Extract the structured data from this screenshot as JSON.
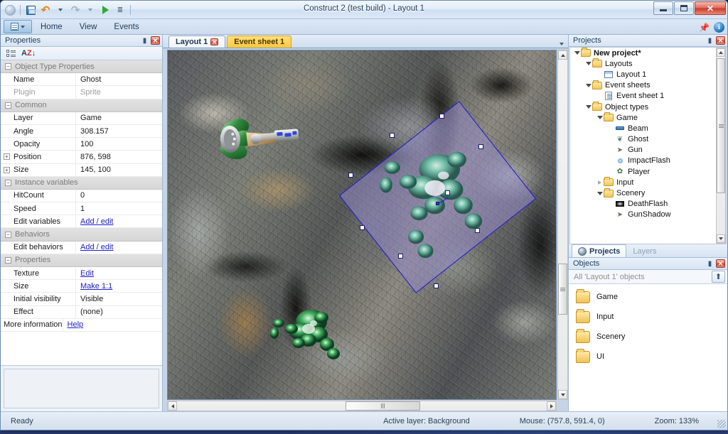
{
  "window": {
    "title": "Construct 2 (test build) - Layout 1",
    "quick_access": [
      {
        "name": "app-orb",
        "icon": "orb-icon"
      },
      {
        "name": "save",
        "icon": "floppy-disk-icon"
      },
      {
        "name": "undo",
        "icon": "undo-arrow-icon"
      },
      {
        "name": "undo-dropdown",
        "icon": "chevron-down-icon"
      },
      {
        "name": "redo",
        "icon": "redo-arrow-icon"
      },
      {
        "name": "redo-dropdown",
        "icon": "chevron-down-icon"
      },
      {
        "name": "run",
        "icon": "play-icon"
      },
      {
        "name": "customize",
        "icon": "overflow-icon"
      }
    ],
    "controls": {
      "minimize": "minimize-icon",
      "maximize": "maximize-icon",
      "close": "✕"
    }
  },
  "ribbon": {
    "app_button": "File menu",
    "tabs": [
      {
        "label": "Home",
        "active": false
      },
      {
        "label": "View",
        "active": false
      },
      {
        "label": "Events",
        "active": false
      }
    ],
    "pin": "🖇",
    "help": "i"
  },
  "properties_panel": {
    "title": "Properties",
    "pin_glyph": "▮",
    "close_glyph": "✕",
    "toolbar": {
      "categorized": "categorized-view-icon",
      "alphabetical_a": "A",
      "alphabetical_z": "Z",
      "sort_arrow": "↓"
    },
    "rows": [
      {
        "kind": "group",
        "name": "Object Type Properties",
        "value": "",
        "expander": "−"
      },
      {
        "kind": "prop",
        "name": "Name",
        "value": "Ghost"
      },
      {
        "kind": "prop",
        "name": "Plugin",
        "value": "Sprite",
        "dim": true
      },
      {
        "kind": "group",
        "name": "Common",
        "value": "",
        "expander": "−"
      },
      {
        "kind": "prop",
        "name": "Layer",
        "value": "Game"
      },
      {
        "kind": "prop",
        "name": "Angle",
        "value": "308.157"
      },
      {
        "kind": "prop",
        "name": "Opacity",
        "value": "100"
      },
      {
        "kind": "prop",
        "name": "Position",
        "value": "876, 598",
        "sub": "+"
      },
      {
        "kind": "prop",
        "name": "Size",
        "value": "145, 100",
        "sub": "+"
      },
      {
        "kind": "group",
        "name": "Instance variables",
        "value": "",
        "expander": "−"
      },
      {
        "kind": "prop",
        "name": "HitCount",
        "value": "0"
      },
      {
        "kind": "prop",
        "name": "Speed",
        "value": "1"
      },
      {
        "kind": "prop",
        "name": "Edit variables",
        "value": "Add / edit",
        "link": true
      },
      {
        "kind": "group",
        "name": "Behaviors",
        "value": "",
        "expander": "−"
      },
      {
        "kind": "prop",
        "name": "Edit behaviors",
        "value": "Add / edit",
        "link": true
      },
      {
        "kind": "group",
        "name": "Properties",
        "value": "",
        "expander": "−"
      },
      {
        "kind": "prop",
        "name": "Texture",
        "value": "Edit",
        "link": true
      },
      {
        "kind": "prop",
        "name": "Size",
        "value": "Make 1:1",
        "link": true
      },
      {
        "kind": "prop",
        "name": "Initial visibility",
        "value": "Visible"
      },
      {
        "kind": "prop",
        "name": "Effect",
        "value": "(none)"
      },
      {
        "kind": "prop",
        "name": "More information",
        "value": "Help",
        "link": true,
        "nosplit": true
      }
    ],
    "description": ""
  },
  "view_tabs": [
    {
      "label": "Layout 1",
      "active": true,
      "closable": true,
      "close_glyph": "✕",
      "kind": "layout"
    },
    {
      "label": "Event sheet 1",
      "active": false,
      "closable": false,
      "kind": "eventsheet"
    }
  ],
  "view_tabs_menu": "chevron-down-icon",
  "canvas": {
    "sprites": [
      {
        "name": "player-gun-sprite",
        "label": "Player"
      },
      {
        "name": "ghost-sprite-green",
        "label": "Ghost"
      },
      {
        "name": "ghost-sprite-selected",
        "label": "Ghost (selected)"
      }
    ],
    "selection": {
      "angle_deg": 308.157,
      "handles": 8,
      "fill_color": "#968ccd",
      "outline_color": "#1b16d6"
    }
  },
  "projects_panel": {
    "title": "Projects",
    "pin_glyph": "▮",
    "close_glyph": "✕",
    "tree": [
      {
        "label": "New project*",
        "depth": 0,
        "icon": "folder-icon",
        "twisty": "open",
        "bold": true
      },
      {
        "label": "Layouts",
        "depth": 1,
        "icon": "folder-icon",
        "twisty": "open"
      },
      {
        "label": "Layout 1",
        "depth": 2,
        "icon": "layout-icon",
        "twisty": "none"
      },
      {
        "label": "Event sheets",
        "depth": 1,
        "icon": "folder-icon",
        "twisty": "open"
      },
      {
        "label": "Event sheet 1",
        "depth": 2,
        "icon": "event-sheet-icon",
        "twisty": "none"
      },
      {
        "label": "Object types",
        "depth": 1,
        "icon": "folder-icon",
        "twisty": "open"
      },
      {
        "label": "Game",
        "depth": 2,
        "icon": "folder-icon",
        "twisty": "open"
      },
      {
        "label": "Beam",
        "depth": 3,
        "icon": "beam-icon",
        "twisty": "none"
      },
      {
        "label": "Ghost",
        "depth": 3,
        "icon": "ghost-icon",
        "twisty": "none"
      },
      {
        "label": "Gun",
        "depth": 3,
        "icon": "gun-icon",
        "twisty": "none"
      },
      {
        "label": "ImpactFlash",
        "depth": 3,
        "icon": "impact-flash-icon",
        "twisty": "none"
      },
      {
        "label": "Player",
        "depth": 3,
        "icon": "player-icon",
        "twisty": "none"
      },
      {
        "label": "Input",
        "depth": 2,
        "icon": "folder-icon",
        "twisty": "closed"
      },
      {
        "label": "Scenery",
        "depth": 2,
        "icon": "folder-icon",
        "twisty": "open"
      },
      {
        "label": "DeathFlash",
        "depth": 3,
        "icon": "death-flash-icon",
        "twisty": "none"
      },
      {
        "label": "GunShadow",
        "depth": 3,
        "icon": "gun-icon",
        "twisty": "none"
      }
    ],
    "dock_tabs": [
      {
        "label": "Projects",
        "active": true,
        "icon": "gear-icon"
      },
      {
        "label": "Layers",
        "active": false
      }
    ]
  },
  "objects_panel": {
    "title": "Objects",
    "pin_glyph": "▮",
    "close_glyph": "✕",
    "filter_placeholder": "All 'Layout 1' objects",
    "up_button": "up-folder-icon",
    "folders": [
      {
        "label": "Game"
      },
      {
        "label": "Input"
      },
      {
        "label": "Scenery"
      },
      {
        "label": "UI"
      }
    ]
  },
  "status_bar": {
    "ready": "Ready",
    "active_layer": "Active layer: Background",
    "mouse": "Mouse: (757.8, 591.4, 0)",
    "zoom": "Zoom: 133%"
  },
  "colors": {
    "accent": "#1b16d6",
    "tab_event": "#ffc83c",
    "close_red": "#c9422f",
    "link": "#1d1dc4"
  }
}
